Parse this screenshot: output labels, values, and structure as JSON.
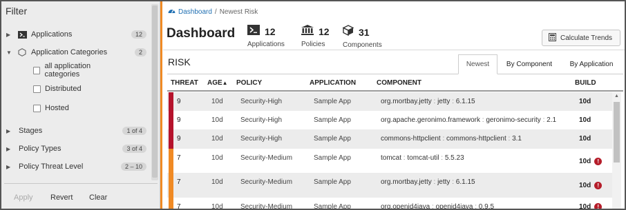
{
  "sidebar": {
    "title": "Filter",
    "items": [
      {
        "label": "Applications",
        "count": "12",
        "icon": "terminal-icon",
        "caret": "▶"
      },
      {
        "label": "Application Categories",
        "count": "2",
        "icon": "hexagon-icon",
        "caret": "▼"
      },
      {
        "label": "Stages",
        "count": "1 of 4",
        "caret": "▶"
      },
      {
        "label": "Policy Types",
        "count": "3 of 4",
        "caret": "▶"
      },
      {
        "label": "Policy Threat Level",
        "count": "2 – 10",
        "caret": "▶"
      }
    ],
    "categories": [
      "all application categories",
      "Distributed",
      "Hosted"
    ],
    "buttons": {
      "apply": "Apply",
      "revert": "Revert",
      "clear": "Clear"
    }
  },
  "breadcrumb": {
    "home": "Dashboard",
    "separator": "/",
    "current": "Newest Risk"
  },
  "header": {
    "title": "Dashboard",
    "stats": [
      {
        "value": "12",
        "label": "Applications",
        "icon": "terminal-icon"
      },
      {
        "value": "12",
        "label": "Policies",
        "icon": "bank-icon"
      },
      {
        "value": "31",
        "label": "Components",
        "icon": "cube-icon"
      }
    ],
    "calc_button": "Calculate Trends"
  },
  "risk": {
    "title": "RISK",
    "tabs": [
      "Newest",
      "By Component",
      "By Application"
    ],
    "active_tab": "Newest",
    "columns": {
      "threat": "THREAT",
      "age": "AGE",
      "sort_arrow": "▲",
      "policy": "POLICY",
      "application": "APPLICATION",
      "component": "COMPONENT",
      "build": "BUILD"
    },
    "rows": [
      {
        "threat": "9",
        "age": "10d",
        "policy": "Security-High",
        "app": "Sample App",
        "group": "org.mortbay.jetty",
        "artifact": "jetty",
        "version": "6.1.15",
        "build": "10d",
        "warn": false
      },
      {
        "threat": "9",
        "age": "10d",
        "policy": "Security-High",
        "app": "Sample App",
        "group": "org.apache.geronimo.framework",
        "artifact": "geronimo-security",
        "version": "2.1",
        "build": "10d",
        "warn": false
      },
      {
        "threat": "9",
        "age": "10d",
        "policy": "Security-High",
        "app": "Sample App",
        "group": "commons-httpclient",
        "artifact": "commons-httpclient",
        "version": "3.1",
        "build": "10d",
        "warn": false
      },
      {
        "threat": "7",
        "age": "10d",
        "policy": "Security-Medium",
        "app": "Sample App",
        "group": "tomcat",
        "artifact": "tomcat-util",
        "version": "5.5.23",
        "build": "10d",
        "warn": true
      },
      {
        "threat": "7",
        "age": "10d",
        "policy": "Security-Medium",
        "app": "Sample App",
        "group": "org.mortbay.jetty",
        "artifact": "jetty",
        "version": "6.1.15",
        "build": "10d",
        "warn": true
      },
      {
        "threat": "7",
        "age": "10d",
        "policy": "Security-Medium",
        "app": "Sample App",
        "group": "org.openid4java",
        "artifact": "openid4java",
        "version": "0.9.5",
        "build": "10d",
        "warn": true
      }
    ]
  },
  "colors": {
    "high": "#b5132c",
    "medium": "#f08a24",
    "accent": "#f08a24",
    "link": "#1f6fb2"
  }
}
